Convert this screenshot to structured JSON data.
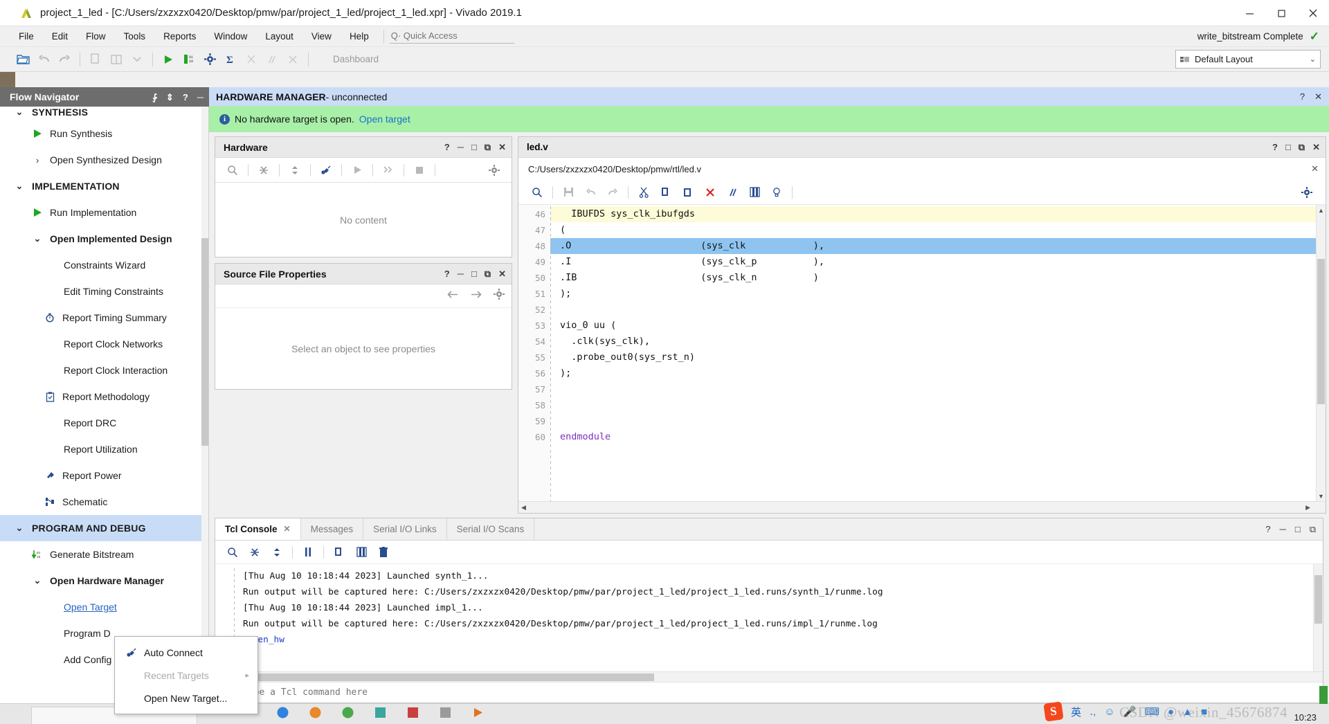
{
  "window": {
    "title": "project_1_led - [C:/Users/zxzxzx0420/Desktop/pmw/par/project_1_led/project_1_led.xpr] - Vivado 2019.1",
    "minimize": "─",
    "maximize": "□",
    "close": "✕"
  },
  "menubar": {
    "items": [
      "File",
      "Edit",
      "Flow",
      "Tools",
      "Reports",
      "Window",
      "Layout",
      "View",
      "Help"
    ],
    "quick_access_placeholder": "Q· Quick Access",
    "status_text": "write_bitstream Complete",
    "status_check": "✓"
  },
  "toolbar": {
    "dashboard_label": "Dashboard",
    "layout_value": "Default Layout",
    "layout_caret": "⌄"
  },
  "flow_navigator": {
    "title": "Flow Navigator",
    "collapse_icon": "⨑",
    "expand_icon": "⇕",
    "help_icon": "?",
    "minimize_icon": "─",
    "items": [
      {
        "label": "SYNTHESIS",
        "type": "section",
        "icon": "chevron-down-icon",
        "clipped": true
      },
      {
        "label": "Run Synthesis",
        "type": "item",
        "icon": "run-icon"
      },
      {
        "label": "Open Synthesized Design",
        "type": "item",
        "icon": "chevron-right-icon"
      },
      {
        "label": "IMPLEMENTATION",
        "type": "section",
        "icon": "chevron-down-icon"
      },
      {
        "label": "Run Implementation",
        "type": "item",
        "icon": "run-icon"
      },
      {
        "label": "Open Implemented Design",
        "type": "item-bold",
        "icon": "chevron-down-icon"
      },
      {
        "label": "Constraints Wizard",
        "type": "sub"
      },
      {
        "label": "Edit Timing Constraints",
        "type": "sub"
      },
      {
        "label": "Report Timing Summary",
        "type": "sub",
        "icon": "timer-icon"
      },
      {
        "label": "Report Clock Networks",
        "type": "sub"
      },
      {
        "label": "Report Clock Interaction",
        "type": "sub"
      },
      {
        "label": "Report Methodology",
        "type": "sub",
        "icon": "clipboard-icon"
      },
      {
        "label": "Report DRC",
        "type": "sub"
      },
      {
        "label": "Report Utilization",
        "type": "sub"
      },
      {
        "label": "Report Power",
        "type": "sub",
        "icon": "power-plug-icon"
      },
      {
        "label": "Schematic",
        "type": "sub",
        "icon": "schematic-icon"
      },
      {
        "label": "PROGRAM AND DEBUG",
        "type": "section-highlight",
        "icon": "chevron-down-icon"
      },
      {
        "label": "Generate Bitstream",
        "type": "item",
        "icon": "bitstream-icon"
      },
      {
        "label": "Open Hardware Manager",
        "type": "item-bold",
        "icon": "chevron-down-icon"
      },
      {
        "label": "Open Target",
        "type": "sub-link"
      },
      {
        "label": "Program D",
        "type": "sub"
      },
      {
        "label": "Add Config",
        "type": "sub"
      }
    ]
  },
  "hardware_manager": {
    "title": "HARDWARE MANAGER",
    "subtitle": " - unconnected",
    "help_icon": "?",
    "close_icon": "✕",
    "banner_text": "No hardware target is open.",
    "banner_link": "Open target",
    "info_icon": "i"
  },
  "hardware_panel": {
    "title": "Hardware",
    "empty_text": "No content",
    "tools": [
      "?",
      "─",
      "□",
      "⧉",
      "✕"
    ]
  },
  "source_file_properties": {
    "title": "Source File Properties",
    "empty_text": "Select an object to see properties",
    "tools": [
      "?",
      "─",
      "□",
      "⧉",
      "✕"
    ]
  },
  "editor": {
    "tab_title": "led.v",
    "file_path": "C:/Users/zxzxzx0420/Desktop/pmw/rtl/led.v",
    "path_close": "✕",
    "tools": [
      "?",
      "□",
      "⧉",
      "✕"
    ],
    "lines": [
      {
        "no": "46",
        "text": "  IBUFDS sys_clk_ibufgds",
        "hl": "yellow"
      },
      {
        "no": "47",
        "text": "(",
        "hl": "none"
      },
      {
        "no": "48",
        "text": ".O                       (sys_clk            ),",
        "hl": "blue"
      },
      {
        "no": "49",
        "text": ".I                       (sys_clk_p          ),",
        "hl": "none"
      },
      {
        "no": "50",
        "text": ".IB                      (sys_clk_n          )",
        "hl": "none"
      },
      {
        "no": "51",
        "text": ");",
        "hl": "none"
      },
      {
        "no": "52",
        "text": "",
        "hl": "none"
      },
      {
        "no": "53",
        "text": "vio_0 uu (",
        "hl": "none"
      },
      {
        "no": "54",
        "text": "  .clk(sys_clk),",
        "hl": "none"
      },
      {
        "no": "55",
        "text": "  .probe_out0(sys_rst_n)",
        "hl": "none"
      },
      {
        "no": "56",
        "text": ");",
        "hl": "none"
      },
      {
        "no": "57",
        "text": "",
        "hl": "none"
      },
      {
        "no": "58",
        "text": "",
        "hl": "none"
      },
      {
        "no": "59",
        "text": "",
        "hl": "none"
      },
      {
        "no": "60",
        "text": "endmodule",
        "hl": "keyword"
      }
    ]
  },
  "tcl_console": {
    "tabs": [
      {
        "label": "Tcl Console",
        "active": true,
        "closable": true
      },
      {
        "label": "Messages",
        "active": false
      },
      {
        "label": "Serial I/O Links",
        "active": false
      },
      {
        "label": "Serial I/O Scans",
        "active": false
      }
    ],
    "tab_close": "✕",
    "tools": [
      "?",
      "─",
      "□",
      "⧉",
      "✕"
    ],
    "output": [
      {
        "text": "[Thu Aug 10 10:18:44 2023] Launched synth_1...",
        "style": "normal"
      },
      {
        "text": "Run output will be captured here: C:/Users/zxzxzx0420/Desktop/pmw/par/project_1_led/project_1_led.runs/synth_1/runme.log",
        "style": "normal"
      },
      {
        "text": "[Thu Aug 10 10:18:44 2023] Launched impl_1...",
        "style": "normal"
      },
      {
        "text": "Run output will be captured here: C:/Users/zxzxzx0420/Desktop/pmw/par/project_1_led/project_1_led.runs/impl_1/runme.log",
        "style": "normal"
      },
      {
        "text": "open_hw",
        "style": "command"
      }
    ],
    "input_placeholder": "Type a Tcl command here"
  },
  "context_menu": {
    "items": [
      {
        "label": "Auto Connect",
        "icon": "connect-icon",
        "disabled": false,
        "submenu": false
      },
      {
        "label": "Recent Targets",
        "icon": "",
        "disabled": true,
        "submenu": true
      },
      {
        "label": "Open New Target...",
        "icon": "",
        "disabled": false,
        "submenu": false
      }
    ],
    "submenu_arrow": "▸"
  },
  "taskbar": {
    "ime_lang": "英",
    "watermark": "CSDN @weixin_45676874",
    "clock": "10:23"
  },
  "colors": {
    "accent_blue": "#cbdcf7",
    "banner_green": "#a8f0a8",
    "link_blue": "#1a6fc9",
    "selection_blue": "#8fc4f0",
    "highlight_yellow": "#fdfbd8",
    "navigator_header": "#6d6d6d"
  }
}
